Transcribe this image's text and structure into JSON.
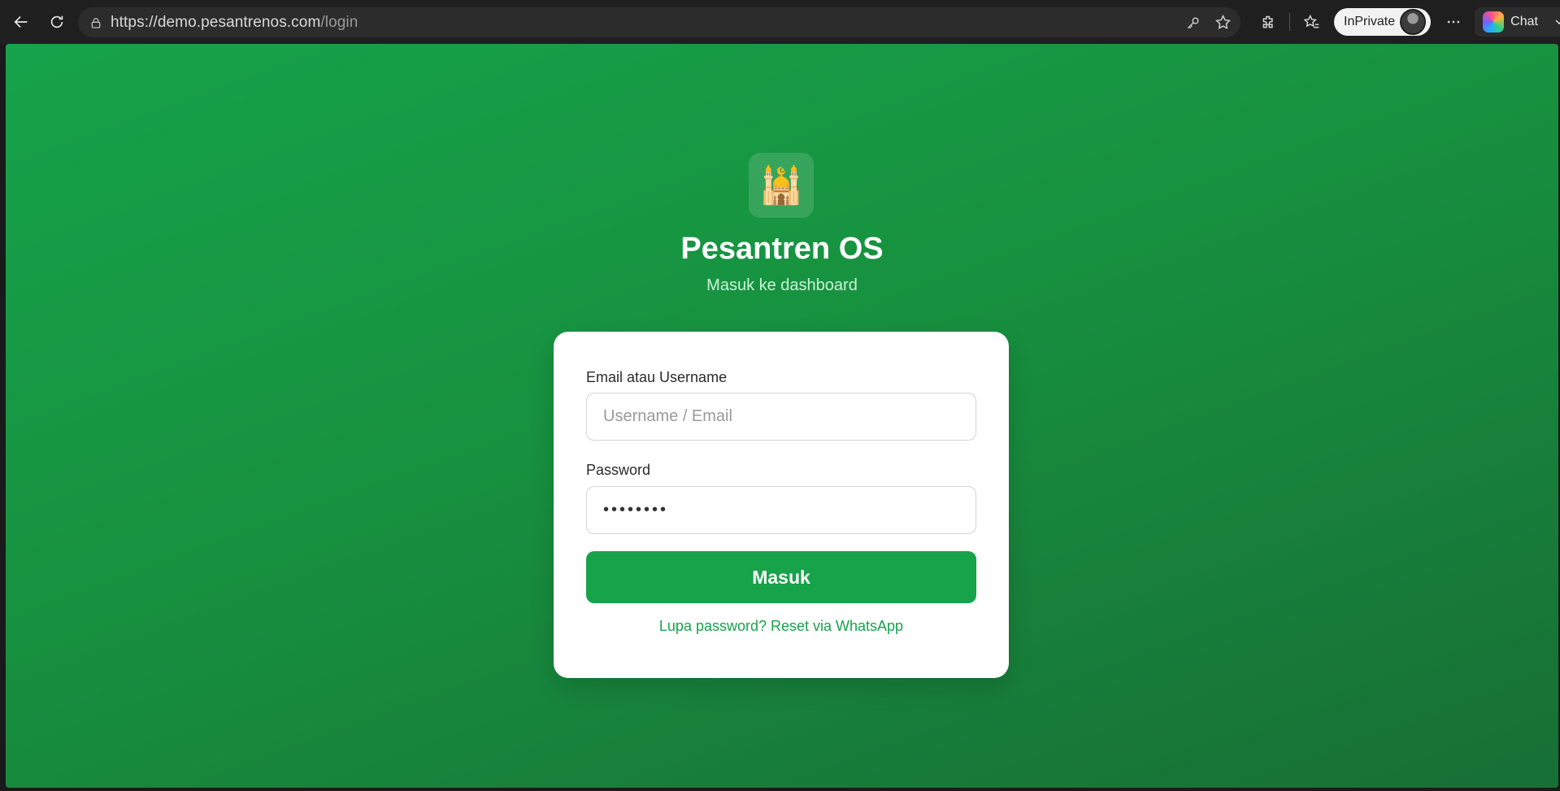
{
  "browser": {
    "url_host": "https://demo.pesantrenos.com",
    "url_path": "/login",
    "inprivate_label": "InPrivate",
    "chat_label": "Chat",
    "icons": [
      "back-icon",
      "refresh-icon",
      "lock-icon",
      "key-icon",
      "star-icon",
      "extensions-icon",
      "favorites-icon",
      "more-icon",
      "copilot-icon",
      "chevron-down-icon"
    ]
  },
  "app": {
    "logo_emoji": "🕌",
    "title": "Pesantren OS",
    "subtitle": "Masuk ke dashboard"
  },
  "form": {
    "email_label": "Email atau Username",
    "email_placeholder": "Username / Email",
    "email_value": "",
    "password_label": "Password",
    "password_value": "••••••••",
    "submit_label": "Masuk",
    "forgot_link": "Lupa password? Reset via WhatsApp"
  },
  "colors": {
    "brand_green": "#16a34a",
    "background_dark_green": "#176f35",
    "subtitle_green": "#c8f5d6"
  }
}
